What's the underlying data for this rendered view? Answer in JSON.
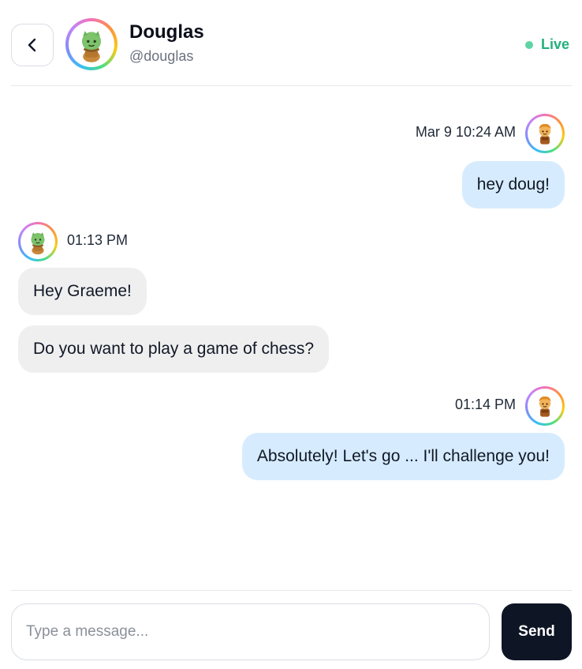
{
  "header": {
    "back_icon": "chevron-left-icon",
    "contact_name": "Douglas",
    "contact_handle": "@douglas",
    "status": "Live",
    "status_color": "#22b07d",
    "avatar_icon": "green-creature-avatar"
  },
  "messages": [
    {
      "direction": "outgoing",
      "timestamp": "Mar 9 10:24 AM",
      "text": "hey doug!",
      "avatar_icon": "orange-character-avatar"
    },
    {
      "direction": "incoming",
      "timestamp": "01:13 PM",
      "texts": [
        "Hey Graeme!",
        "Do you want to play a game of chess?"
      ],
      "avatar_icon": "green-creature-avatar"
    },
    {
      "direction": "outgoing",
      "timestamp": "01:14 PM",
      "text": "Absolutely! Let's go ... I'll challenge you!",
      "avatar_icon": "orange-character-avatar"
    }
  ],
  "composer": {
    "placeholder": "Type a message...",
    "value": "",
    "send_label": "Send"
  },
  "colors": {
    "outgoing_bubble": "#d6ecfe",
    "incoming_bubble": "#efefef",
    "send_button": "#0e1525"
  }
}
